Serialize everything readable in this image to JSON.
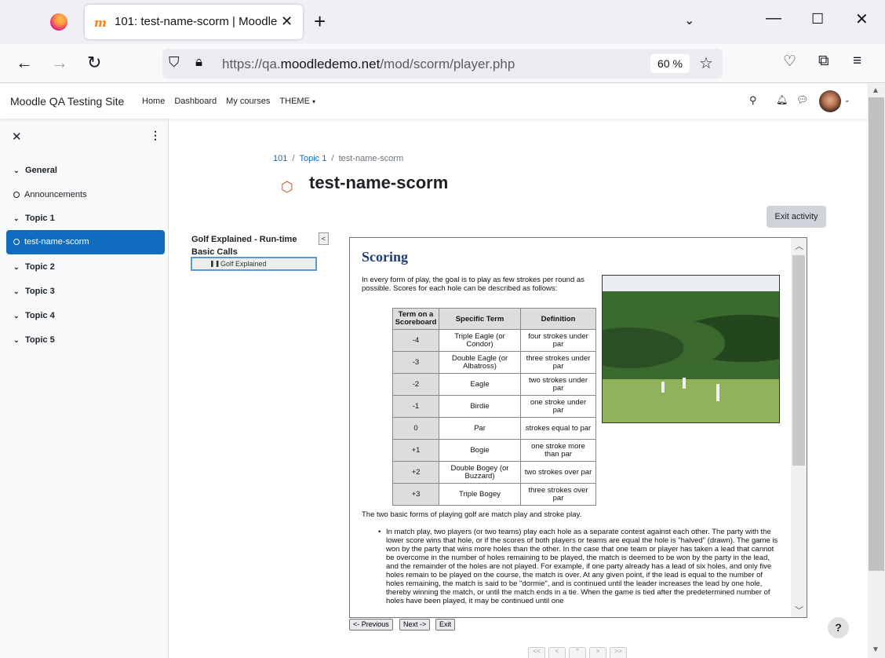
{
  "browser": {
    "tab_title": "101: test-name-scorm | Moodle",
    "tab_favicon": "moodle-icon",
    "url_prefix": "https://qa.",
    "url_domain": "moodledemo.net",
    "url_path": "/mod/scorm/player.php",
    "zoom": "60 %"
  },
  "site": {
    "name": "Moodle QA Testing Site",
    "nav": [
      "Home",
      "Dashboard",
      "My courses",
      "THEME"
    ]
  },
  "drawer": {
    "items": [
      {
        "label": "General",
        "type": "section"
      },
      {
        "label": "Announcements",
        "type": "activity"
      },
      {
        "label": "Topic 1",
        "type": "section"
      },
      {
        "label": "test-name-scorm",
        "type": "activity",
        "active": true
      },
      {
        "label": "Topic 2",
        "type": "section"
      },
      {
        "label": "Topic 3",
        "type": "section"
      },
      {
        "label": "Topic 4",
        "type": "section"
      },
      {
        "label": "Topic 5",
        "type": "section"
      }
    ]
  },
  "breadcrumb": [
    "101",
    "Topic 1",
    "test-name-scorm"
  ],
  "page": {
    "title": "test-name-scorm",
    "exit_activity": "Exit activity"
  },
  "toc": {
    "title": "Golf Explained - Run-time Basic Calls",
    "toggle": "<",
    "node": "Golf Explained"
  },
  "content": {
    "heading": "Scoring",
    "intro": "In every form of play, the goal is to play as few strokes per round as possible. Scores for each hole can be described as follows:",
    "table": {
      "headers": [
        "Term on a Scoreboard",
        "Specific Term",
        "Definition"
      ],
      "rows": [
        [
          "-4",
          "Triple Eagle (or Condor)",
          "four strokes under par"
        ],
        [
          "-3",
          "Double Eagle (or Albatross)",
          "three strokes under par"
        ],
        [
          "-2",
          "Eagle",
          "two strokes under par"
        ],
        [
          "-1",
          "Birdie",
          "one stroke under par"
        ],
        [
          "0",
          "Par",
          "strokes equal to par"
        ],
        [
          "+1",
          "Bogie",
          "one stroke more than par"
        ],
        [
          "+2",
          "Double Bogey (or Buzzard)",
          "two strokes over par"
        ],
        [
          "+3",
          "Triple Bogey",
          "three strokes over par"
        ]
      ]
    },
    "two_forms": "The two basic forms of playing golf are match play and stroke play.",
    "bullet": "In match play, two players (or two teams) play each hole as a separate contest against each other. The party with the lower score wins that hole, or if the scores of both players or teams are equal the hole is \"halved\" (drawn). The game is won by the party that wins more holes than the other. In the case that one team or player has taken a lead that cannot be overcome in the number of holes remaining to be played, the match is deemed to be won by the party in the lead, and the remainder of the holes are not played. For example, if one party already has a lead of six holes, and only five holes remain to be played on the course, the match is over. At any given point, if the lead is equal to the number of holes remaining, the match is said to be \"dormie\", and is continued until the leader increases the lead by one hole, thereby winning the match, or until the match ends in a tie. When the game is tied after the predetermined number of holes have been played, it may be continued until one"
  },
  "scorm_nav": {
    "previous": "<- Previous",
    "next": "Next ->",
    "exit": "Exit"
  },
  "pagers": [
    "<<",
    "<",
    "^",
    ">",
    ">>"
  ],
  "help": "?"
}
